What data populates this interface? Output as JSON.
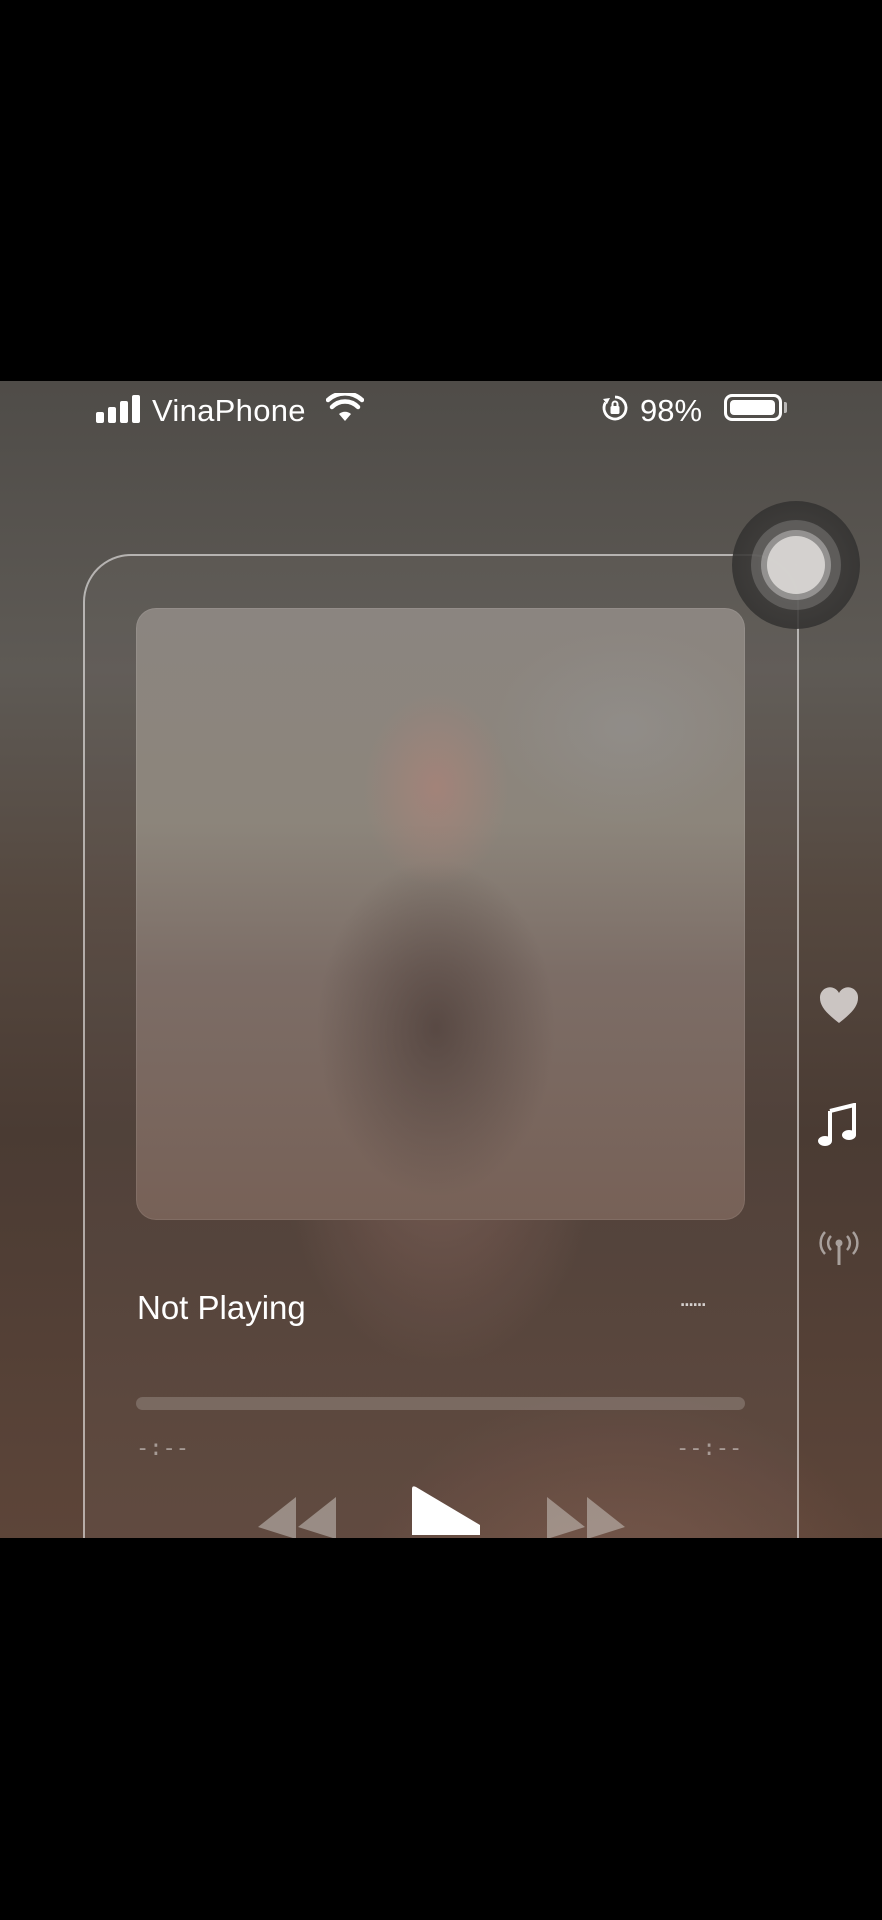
{
  "status_bar": {
    "carrier": "VinaPhone",
    "battery_percent": "98%",
    "battery_level": 0.98,
    "icons": [
      "signal-icon",
      "wifi-icon",
      "orientation-lock-icon",
      "battery-icon"
    ]
  },
  "player": {
    "title": "Not Playing",
    "more_label": "......",
    "elapsed": "-:--",
    "remaining": "--:--",
    "progress": 0,
    "controls": [
      "rewind-icon",
      "play-icon",
      "fast-forward-icon"
    ]
  },
  "side_tabs": [
    "heart-icon",
    "music-note-icon",
    "radio-broadcast-icon"
  ],
  "colors": {
    "text": "#ffffff",
    "muted_text": "rgba(255,255,255,0.45)",
    "background": "#5a4f48"
  }
}
